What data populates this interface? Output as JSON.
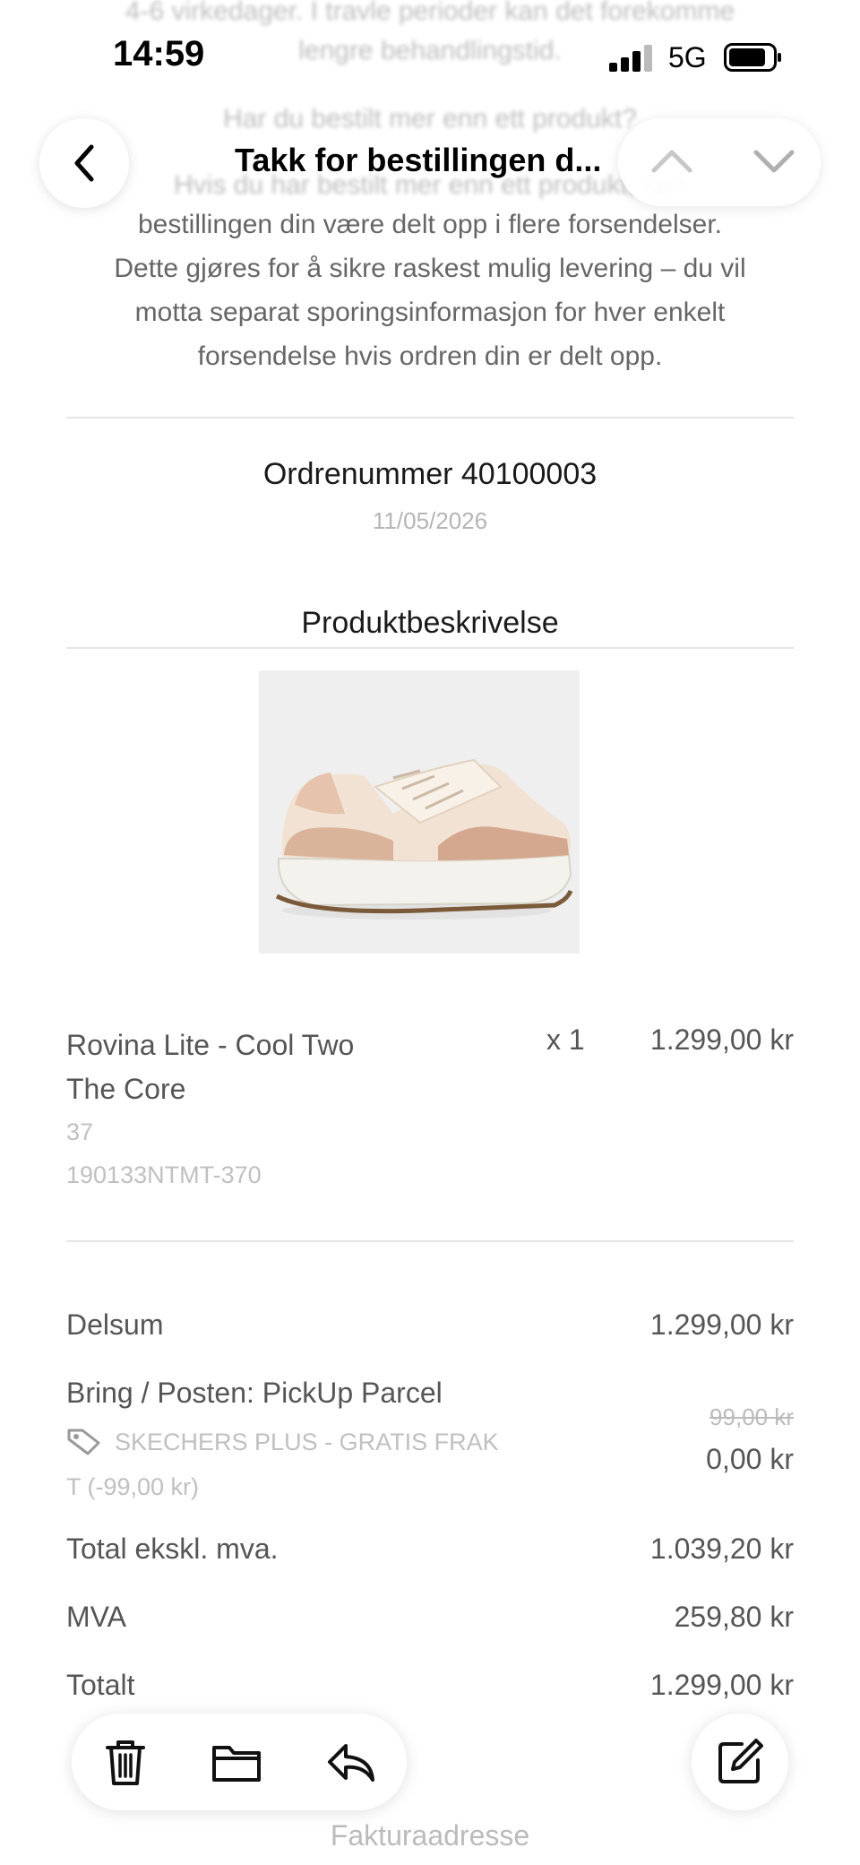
{
  "status_bar": {
    "time": "14:59",
    "network": "5G"
  },
  "header": {
    "subject": "Takk for bestillingen d..."
  },
  "email": {
    "faded_top_1": "4-6 virkedager. I travle perioder kan det forekomme",
    "faded_top_2": "lengre behandlingstid.",
    "faded_top_3": "Har du bestilt mer enn ett produkt?",
    "faded_top_4": "Hvis du har bestilt mer enn ett produkt, kan",
    "intro_lines": [
      "bestillingen din være delt opp i flere forsendelser.",
      "Dette gjøres for å sikre raskest mulig levering – du vil",
      "motta separat sporingsinformasjon for hver enkelt",
      "forsendelse hvis ordren din er delt opp."
    ],
    "order_number": "Ordrenummer 40100003",
    "order_date": "11/05/2026",
    "section_title": "Produktbeskrivelse",
    "product": {
      "name_line1": "Rovina Lite - Cool Two",
      "name_line2": "The Core",
      "quantity": "x 1",
      "price": "1.299,00 kr",
      "size": "37",
      "sku": "190133NTMT-370"
    },
    "summary": {
      "subtotal_label": "Delsum",
      "subtotal_value": "1.299,00 kr",
      "shipping_label": "Bring / Posten: PickUp Parcel",
      "shipping_original": "99,00 kr",
      "shipping_value": "0,00 kr",
      "coupon_line1": "SKECHERS PLUS - GRATIS FRAK",
      "coupon_line2": "T (-99,00 kr)",
      "excl_vat_label": "Total ekskl. mva.",
      "excl_vat_value": "1.039,20 kr",
      "vat_label": "MVA",
      "vat_value": "259,80 kr",
      "total_label": "Totalt",
      "total_value": "1.299,00 kr"
    },
    "footer_faded": "Fakturaadresse"
  },
  "toolbar": {
    "icons": [
      "trash-icon",
      "folder-icon",
      "reply-icon",
      "compose-icon"
    ]
  }
}
